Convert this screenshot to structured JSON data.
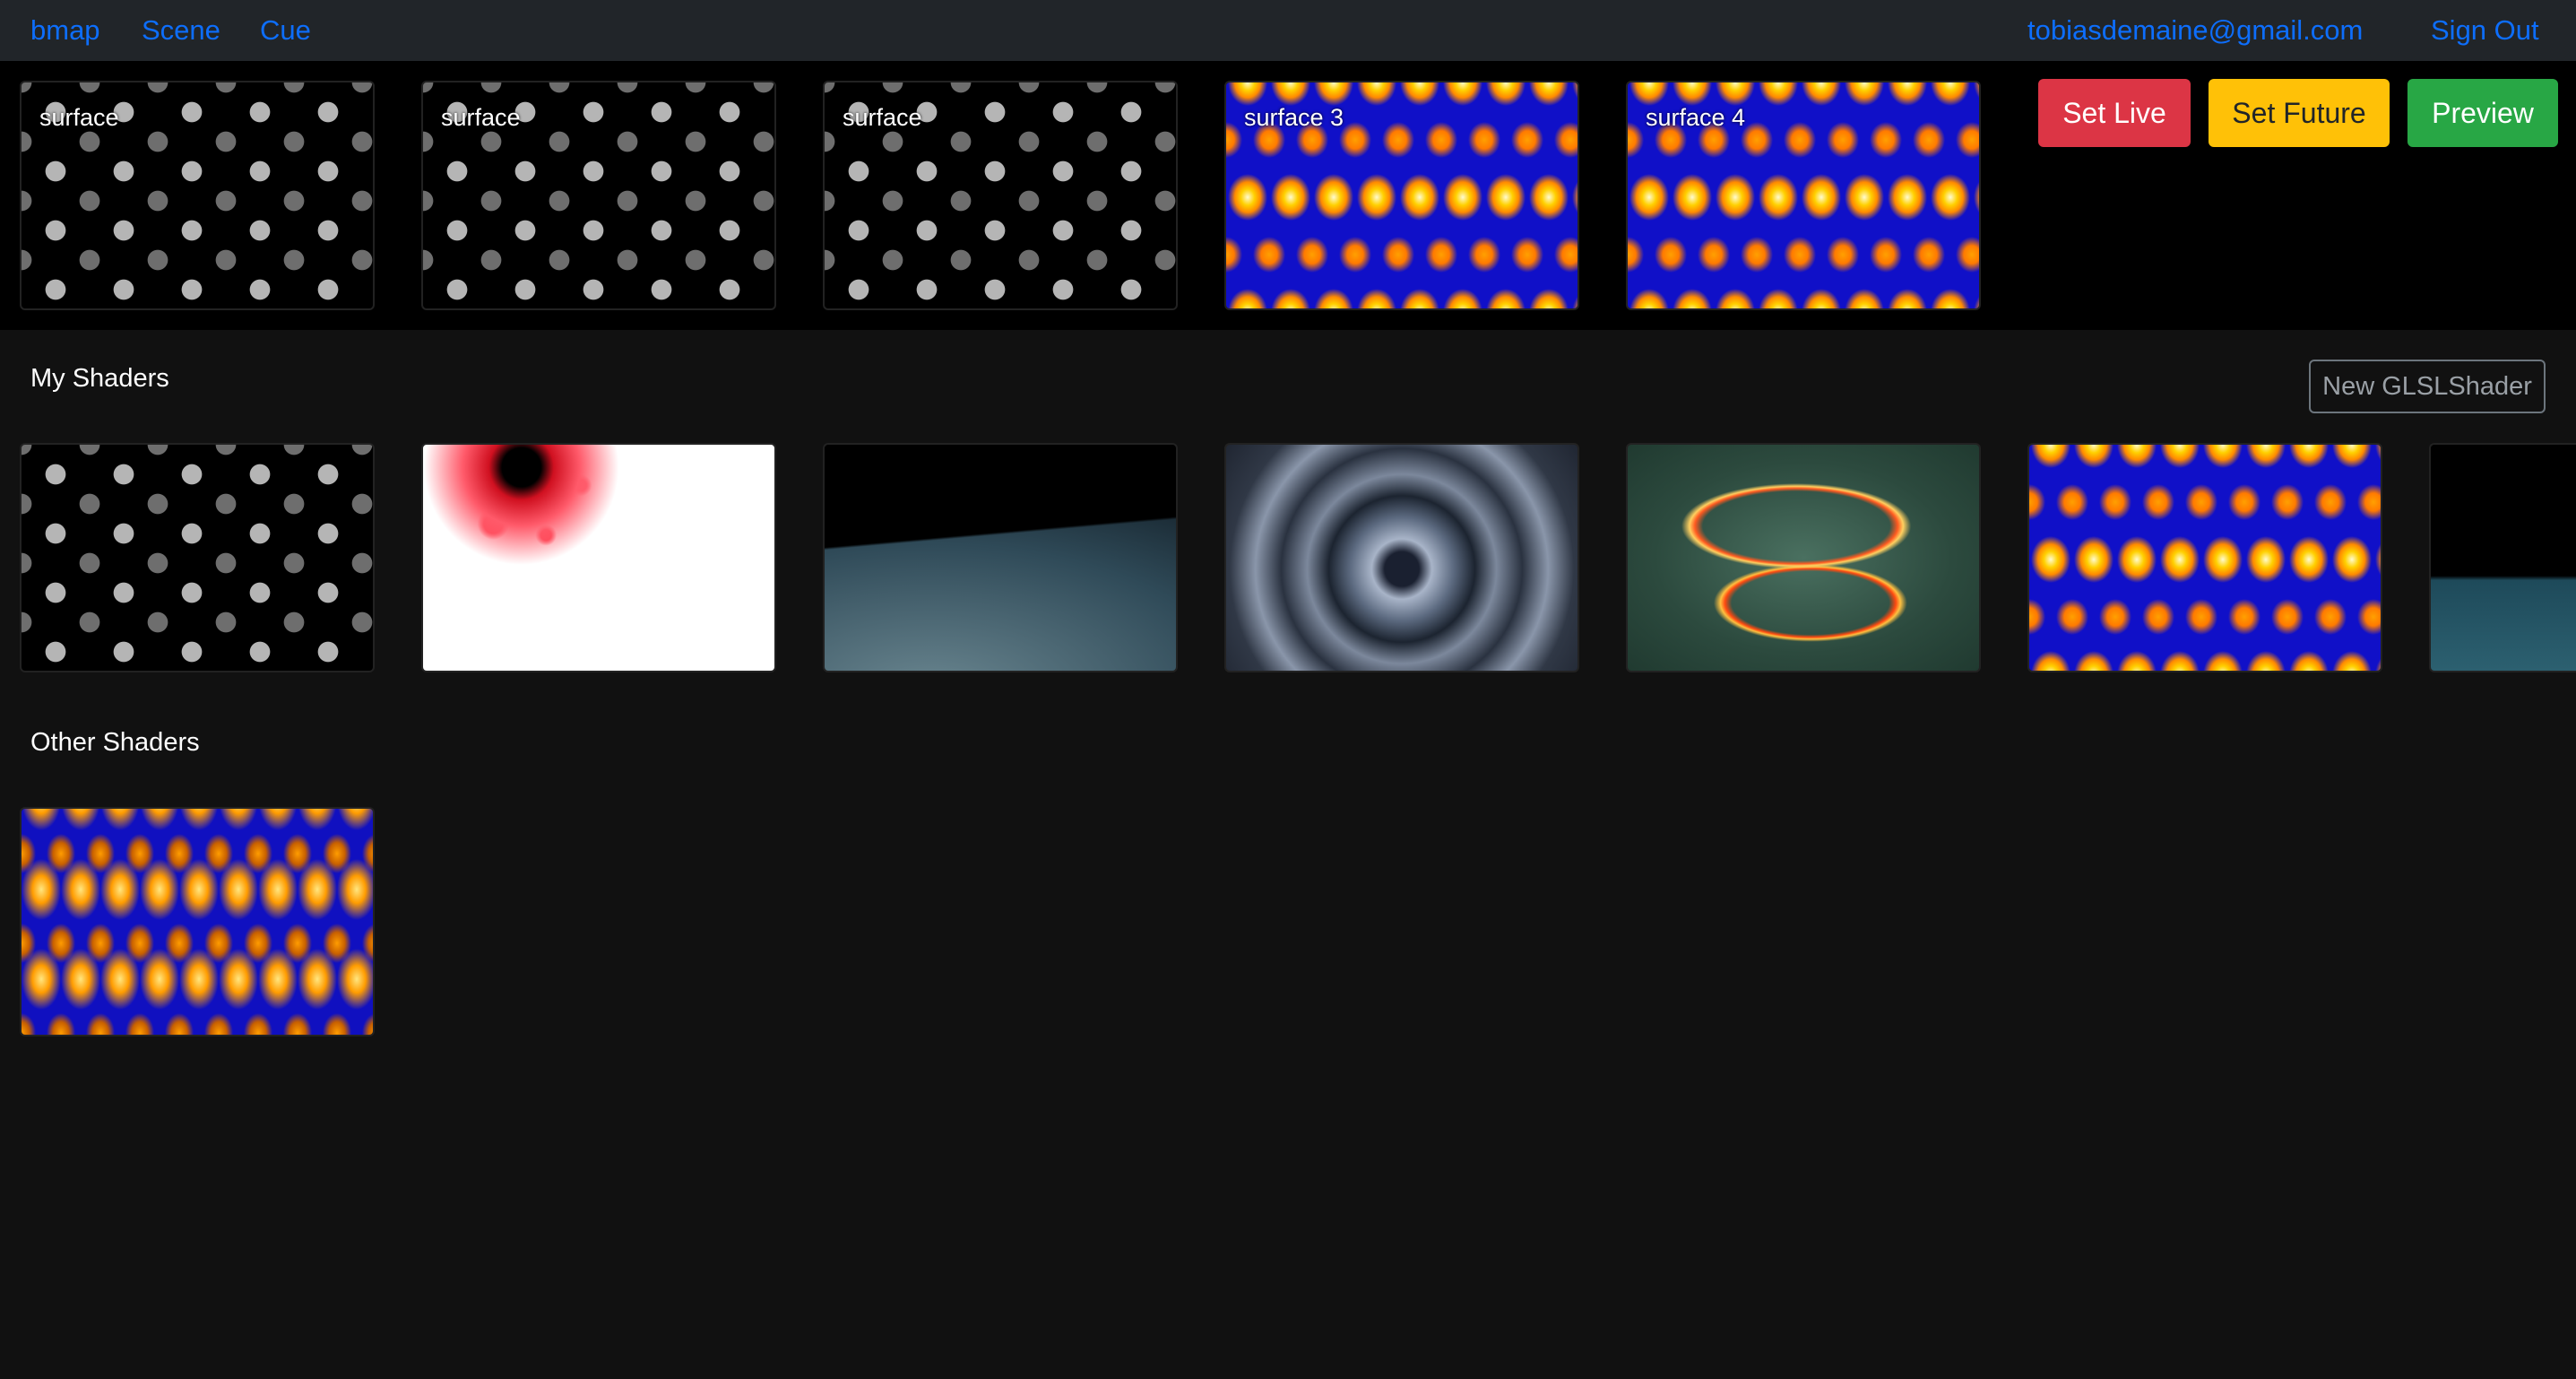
{
  "nav": {
    "brand": "bmap",
    "scene": "Scene",
    "cue": "Cue",
    "email": "tobiasdemaine@gmail.com",
    "sign_out": "Sign Out"
  },
  "surfaces": [
    {
      "label": "surface",
      "thumbnail": "cubes"
    },
    {
      "label": "surface",
      "thumbnail": "cubes"
    },
    {
      "label": "surface",
      "thumbnail": "cubes"
    },
    {
      "label": "surface 3",
      "thumbnail": "orange-blue"
    },
    {
      "label": "surface 4",
      "thumbnail": "orange-blue"
    }
  ],
  "actions": {
    "set_live": "Set Live",
    "set_future": "Set Future",
    "preview": "Preview"
  },
  "my_shaders": {
    "title": "My Shaders",
    "new_button": "New GLSLShader",
    "items": [
      "cubes",
      "red-dots",
      "ocean",
      "tunnel",
      "spiral",
      "orange-blue",
      "teal-dark"
    ]
  },
  "other_shaders": {
    "title": "Other Shaders",
    "items": [
      "orange-blue2"
    ]
  },
  "colors": {
    "link": "#0d6efd",
    "danger": "#dc3545",
    "warning": "#ffc107",
    "success": "#28a745"
  }
}
